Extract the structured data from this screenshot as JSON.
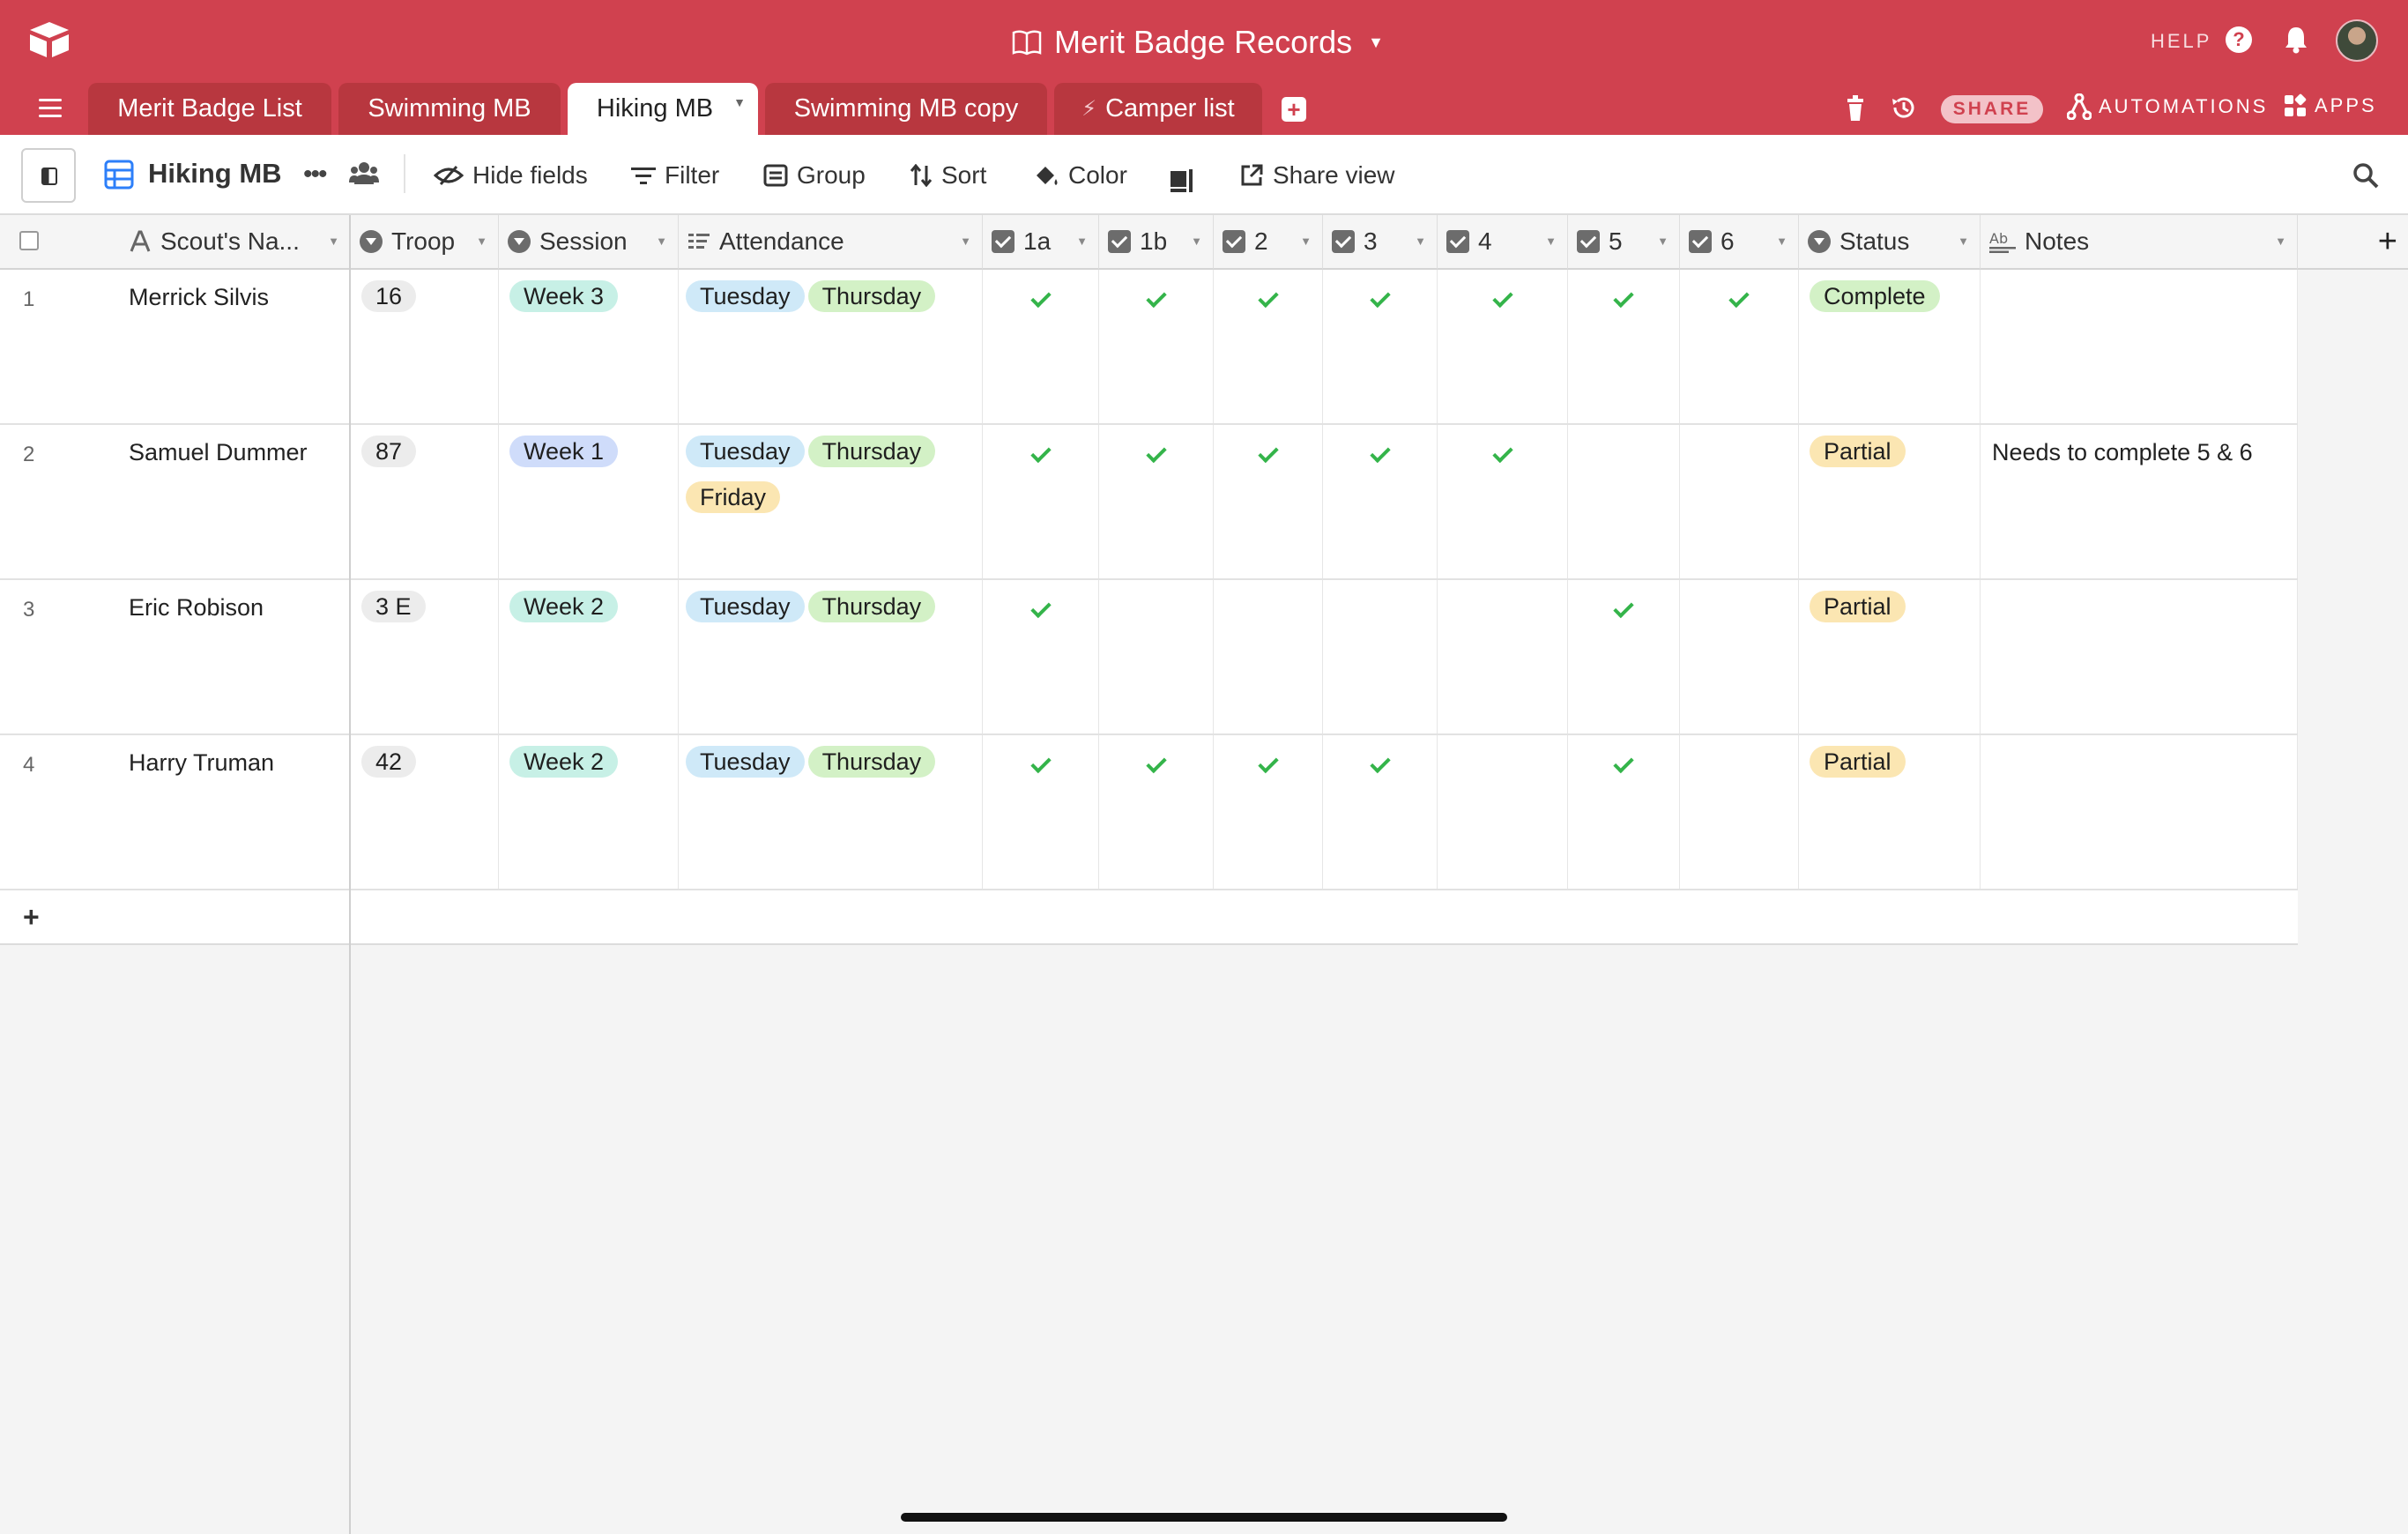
{
  "app": {
    "base_title": "Merit Badge Records",
    "help_label": "HELP"
  },
  "tabs": [
    {
      "label": "Merit Badge List",
      "active": false
    },
    {
      "label": "Swimming MB",
      "active": false
    },
    {
      "label": "Hiking MB",
      "active": true
    },
    {
      "label": "Swimming MB copy",
      "active": false
    },
    {
      "label": "Camper list",
      "active": false,
      "icon": "bolt-icon"
    }
  ],
  "header_actions": {
    "share": "SHARE",
    "automations": "AUTOMATIONS",
    "apps": "APPS"
  },
  "toolbar": {
    "view_name": "Hiking MB",
    "hide_fields": "Hide fields",
    "filter": "Filter",
    "group": "Group",
    "sort": "Sort",
    "color": "Color",
    "share_view": "Share view"
  },
  "columns": {
    "scout_name": "Scout's Na...",
    "troop": "Troop",
    "session": "Session",
    "attendance": "Attendance",
    "req_1a": "1a",
    "req_1b": "1b",
    "req_2": "2",
    "req_3": "3",
    "req_4": "4",
    "req_5": "5",
    "req_6": "6",
    "status": "Status",
    "notes": "Notes"
  },
  "rows": [
    {
      "num": "1",
      "name": "Merrick Silvis",
      "troop": "16",
      "session": "Week 3",
      "attendance": [
        "Tuesday",
        "Thursday"
      ],
      "checks": [
        true,
        true,
        true,
        true,
        true,
        true,
        true
      ],
      "status": "Complete",
      "notes": ""
    },
    {
      "num": "2",
      "name": "Samuel Dummer",
      "troop": "87",
      "session": "Week 1",
      "attendance": [
        "Tuesday",
        "Thursday",
        "Friday"
      ],
      "checks": [
        true,
        true,
        true,
        true,
        true,
        false,
        false
      ],
      "status": "Partial",
      "notes": "Needs to complete 5 & 6"
    },
    {
      "num": "3",
      "name": "Eric Robison",
      "troop": "3 E",
      "session": "Week 2",
      "attendance": [
        "Tuesday",
        "Thursday"
      ],
      "checks": [
        true,
        false,
        false,
        false,
        false,
        true,
        false
      ],
      "status": "Partial",
      "notes": ""
    },
    {
      "num": "4",
      "name": "Harry Truman",
      "troop": "42",
      "session": "Week 2",
      "attendance": [
        "Tuesday",
        "Thursday"
      ],
      "checks": [
        true,
        true,
        true,
        true,
        false,
        true,
        false
      ],
      "status": "Partial",
      "notes": ""
    }
  ],
  "colors": {
    "brand_red": "#d0414f",
    "check_green": "#34b44a",
    "pill_week3": "#c7f0e6",
    "pill_week1": "#cfdcfa",
    "pill_week2": "#c7f0e6",
    "pill_tuesday": "#cfe9f8",
    "pill_thursday": "#d3f1c6",
    "pill_friday": "#fbe6b2",
    "pill_complete": "#d3f1c6",
    "pill_partial": "#fbe6b2"
  }
}
